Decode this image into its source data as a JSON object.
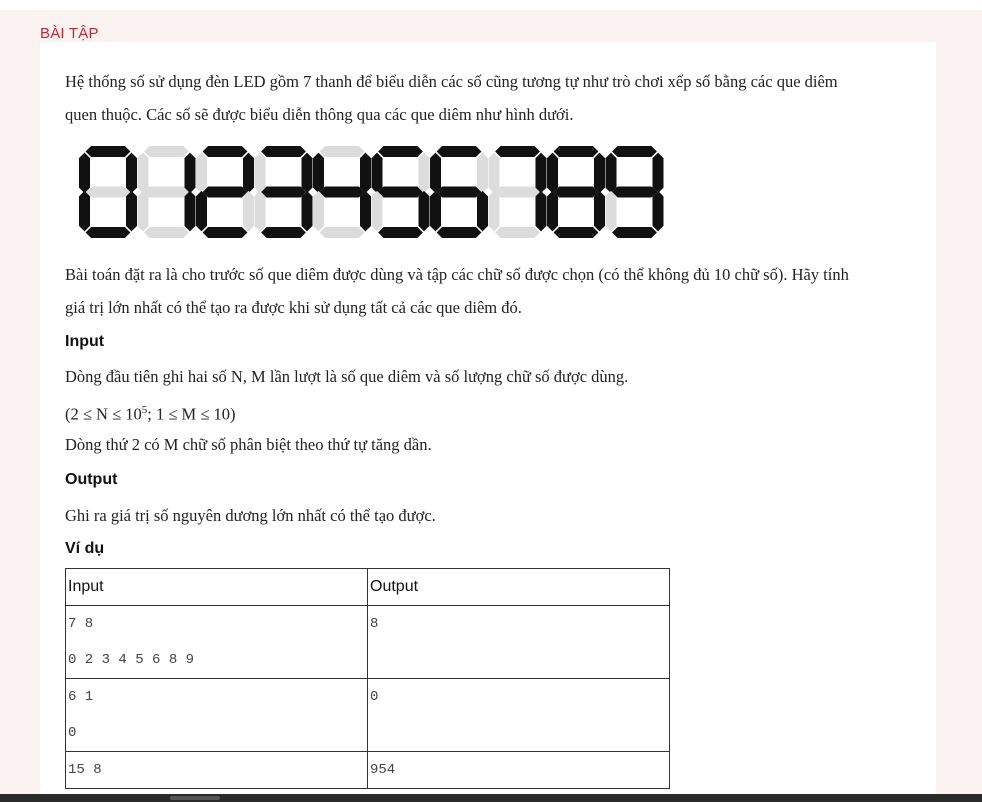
{
  "header": {
    "title": "BÀI TẬP"
  },
  "intro": {
    "line1": "Hệ thống số sử dụng đèn LED gồm 7 thanh để biểu diễn các số cũng tương tự như trò chơi xếp số bằng các que diêm",
    "line2": "quen thuộc. Các số sẽ được biểu diễn thông qua các que diêm như hình dưới."
  },
  "digits": [
    "0",
    "1",
    "2",
    "3",
    "4",
    "5",
    "6",
    "7",
    "8",
    "9"
  ],
  "colors": {
    "segment_on": "#111111",
    "segment_off": "#dcdcdc",
    "header": "#c0282d"
  },
  "task": {
    "line1": "Bài toán đặt ra là cho trước số que diêm được dùng và tập các chữ số được chọn (có thể không đủ 10 chữ số). Hãy tính",
    "line2": "giá trị lớn nhất có thể tạo ra được khi sử dụng tất cả các que diêm đó."
  },
  "input_section": {
    "heading": "Input",
    "line1": "Dòng đầu tiên ghi hai số N, M lần lượt là số que diêm và số lượng chữ số được dùng.",
    "constraint_pre": "(2 ≤ N ≤ 10",
    "constraint_sup": "5",
    "constraint_post": "; 1 ≤ M ≤ 10)",
    "line2": "Dòng thứ 2 có M chữ số phân biệt theo thứ tự tăng dần."
  },
  "output_section": {
    "heading": "Output",
    "line1": "Ghi ra giá trị số nguyên dương lớn nhất có thể tạo được."
  },
  "example": {
    "heading": "Ví dụ",
    "columns": [
      "Input",
      "Output"
    ],
    "rows": [
      {
        "input": [
          "7 8",
          "0 2 3 4 5 6 8 9"
        ],
        "output": "8"
      },
      {
        "input": [
          "6 1",
          "0"
        ],
        "output": "0"
      },
      {
        "input": [
          "15 8"
        ],
        "output": "954"
      }
    ]
  }
}
